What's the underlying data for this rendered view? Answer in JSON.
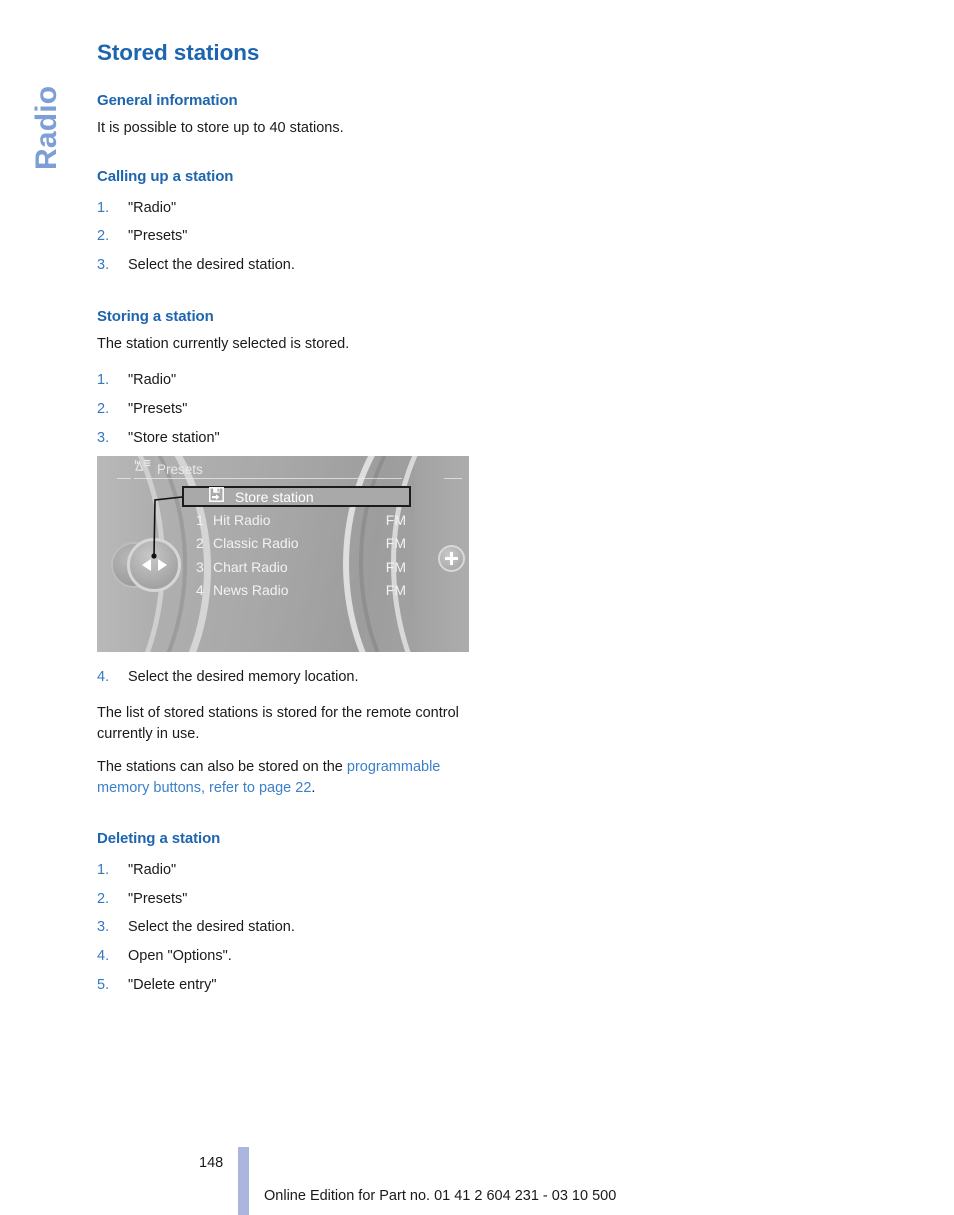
{
  "chapter_tab": {
    "label": "Radio"
  },
  "page": {
    "title": "Stored stations",
    "number": "148",
    "footer_note": "Online Edition for Part no. 01 41 2 604 231 - 03 10 500"
  },
  "sections": {
    "general": {
      "heading": "General information",
      "body": "It is possible to store up to 40 stations."
    },
    "calling_up": {
      "heading": "Calling up a station",
      "steps": [
        {
          "num": "1.",
          "text": "\"Radio\""
        },
        {
          "num": "2.",
          "text": "\"Presets\""
        },
        {
          "num": "3.",
          "text": "Select the desired station."
        }
      ]
    },
    "storing": {
      "heading": "Storing a station",
      "intro": "The station currently selected is stored.",
      "steps": [
        {
          "num": "1.",
          "text": "\"Radio\""
        },
        {
          "num": "2.",
          "text": "\"Presets\""
        },
        {
          "num": "3.",
          "text": "\"Store station\""
        }
      ],
      "step4": {
        "num": "4.",
        "text": "Select the desired memory location."
      },
      "note1": "The list of stored stations is stored for the remote control currently in use.",
      "note2_prefix": "The stations can also be stored on the ",
      "note2_link": "programmable memory buttons, refer to page 22",
      "note2_suffix": "."
    },
    "deleting": {
      "heading": "Deleting a station",
      "steps": [
        {
          "num": "1.",
          "text": "\"Radio\""
        },
        {
          "num": "2.",
          "text": "\"Presets\""
        },
        {
          "num": "3.",
          "text": "Select the desired station."
        },
        {
          "num": "4.",
          "text": "Open \"Options\"."
        },
        {
          "num": "5.",
          "text": "\"Delete entry\""
        }
      ]
    }
  },
  "idrive": {
    "header_icon": "radio-antenna-list-icon",
    "header_label": "Presets",
    "store_row": {
      "icon": "save-floppy-icon",
      "label": "Store station"
    },
    "stations": [
      {
        "index": "1",
        "name": "Hit Radio",
        "band": "FM"
      },
      {
        "index": "2",
        "name": "Classic Radio",
        "band": "FM"
      },
      {
        "index": "3",
        "name": "Chart Radio",
        "band": "FM"
      },
      {
        "index": "4",
        "name": "News Radio",
        "band": "FM"
      }
    ],
    "controller": {
      "left_icon": "arrow-left-icon",
      "right_icon": "arrow-right-icon"
    },
    "plus_button": "plus-icon"
  },
  "colors": {
    "heading_blue": "#1e65b0",
    "step_number_blue": "#3379c0",
    "link_blue": "#3b80c9",
    "chapter_tab_blue": "#7d9fd6",
    "footer_bar": "#aab6dd",
    "body_text": "#1a1a1a"
  }
}
